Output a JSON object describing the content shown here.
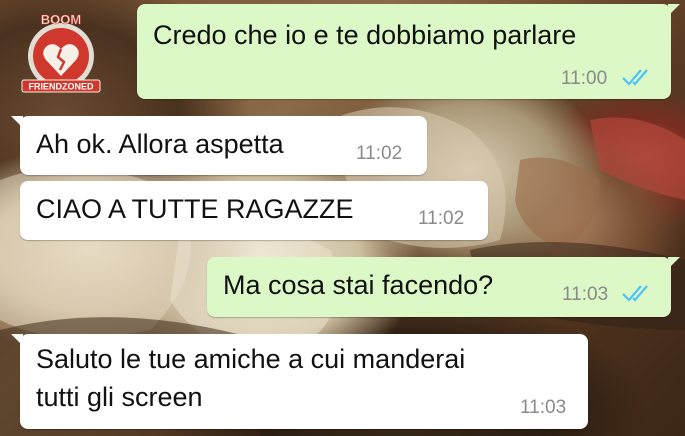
{
  "watermark": {
    "top_text": "BOOM",
    "bottom_text": "FRIENDZONED"
  },
  "colors": {
    "outgoing_bubble": "#dcf8c6",
    "incoming_bubble": "#ffffff",
    "read_ticks": "#4fc3f7"
  },
  "messages": [
    {
      "direction": "outgoing",
      "text": "Credo che io e te dobbiamo parlare",
      "time": "11:00",
      "status": "read"
    },
    {
      "direction": "incoming",
      "text": "Ah ok. Allora aspetta",
      "time": "11:02"
    },
    {
      "direction": "incoming",
      "text": "CIAO A TUTTE RAGAZZE",
      "time": "11:02"
    },
    {
      "direction": "outgoing",
      "text": "Ma cosa stai facendo?",
      "time": "11:03",
      "status": "read"
    },
    {
      "direction": "incoming",
      "text_lines": [
        "Saluto le tue amiche a cui manderai",
        "tutti gli screen"
      ],
      "time": "11:03"
    }
  ]
}
